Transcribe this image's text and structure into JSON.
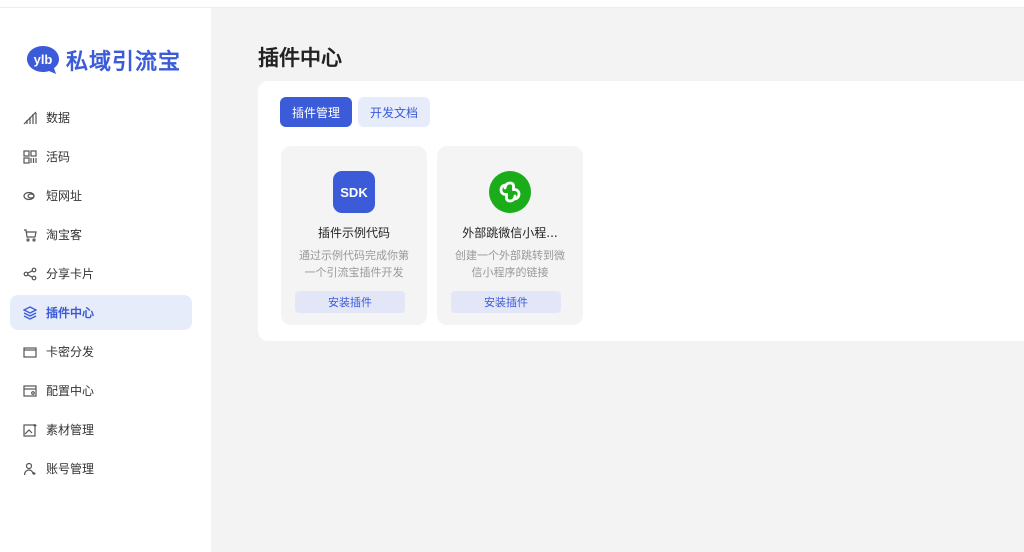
{
  "brand": {
    "badge_text": "ylb",
    "name": "私域引流宝",
    "color": "#3b5bd9"
  },
  "sidebar": {
    "items": [
      {
        "label": "数据",
        "icon": "chart-bars-icon",
        "active": false
      },
      {
        "label": "活码",
        "icon": "qr-grid-icon",
        "active": false
      },
      {
        "label": "短网址",
        "icon": "link-icon",
        "active": false
      },
      {
        "label": "淘宝客",
        "icon": "cart-icon",
        "active": false
      },
      {
        "label": "分享卡片",
        "icon": "share-icon",
        "active": false
      },
      {
        "label": "插件中心",
        "icon": "layers-icon",
        "active": true
      },
      {
        "label": "卡密分发",
        "icon": "card-icon",
        "active": false
      },
      {
        "label": "配置中心",
        "icon": "config-icon",
        "active": false
      },
      {
        "label": "素材管理",
        "icon": "image-icon",
        "active": false
      },
      {
        "label": "账号管理",
        "icon": "user-add-icon",
        "active": false
      }
    ]
  },
  "main": {
    "title": "插件中心",
    "tabs": [
      {
        "label": "插件管理",
        "active": true
      },
      {
        "label": "开发文档",
        "active": false
      }
    ],
    "plugins": [
      {
        "icon_text": "SDK",
        "icon_color": "#3b5bd9",
        "name": "插件示例代码",
        "desc_line1": "通过示例代码完成你第",
        "desc_line2": "一个引流宝插件开发",
        "button": "安装插件"
      },
      {
        "icon_text": "",
        "icon_color": "#1aad19",
        "name": "外部跳微信小程...",
        "desc_line1": "创建一个外部跳转到微",
        "desc_line2": "信小程序的链接",
        "button": "安装插件"
      }
    ]
  }
}
